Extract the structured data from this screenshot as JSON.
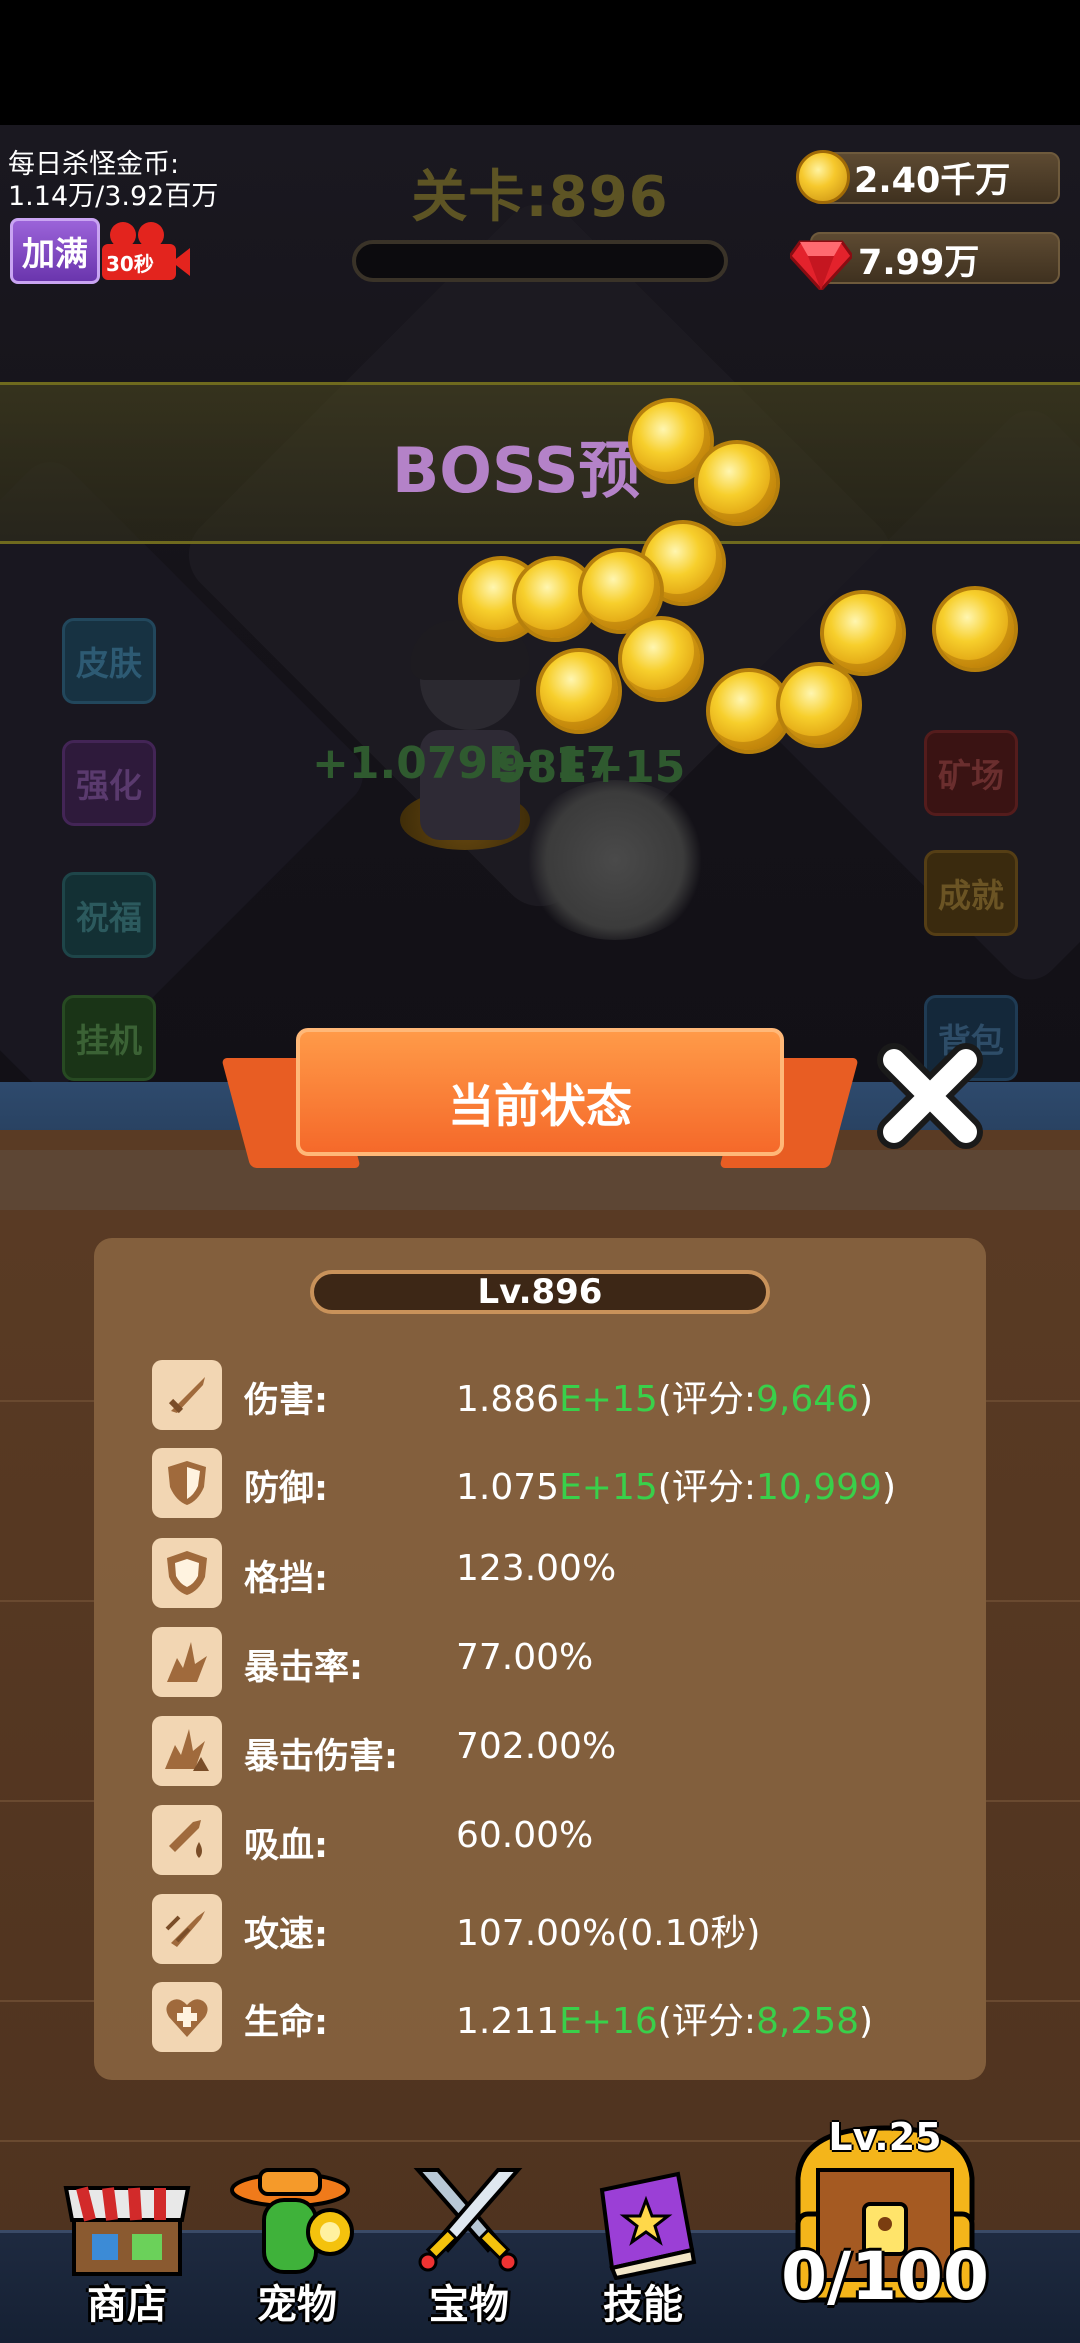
{
  "hud": {
    "kill_gold_label": "每日杀怪金币:",
    "kill_gold_value": "1.14万/3.92百万",
    "fill_button": "加满",
    "video_timer": "30秒",
    "level_title": "关卡:896",
    "gold": "2.40千万",
    "gems": "7.99万"
  },
  "scene": {
    "boss_banner": "BOSS预",
    "damage_popup_1": "+1.079E+17",
    "damage_popup_2": "98E+15"
  },
  "left_menu": [
    "皮肤",
    "强化",
    "祝福",
    "挂机"
  ],
  "right_menu": [
    "矿场",
    "成就",
    "背包"
  ],
  "status_panel": {
    "title": "当前状态",
    "level": "Lv.896",
    "stats": [
      {
        "icon": "sword-icon",
        "label": "伤害:",
        "base": "1.886",
        "exp": "E+15",
        "pre": "(评分:",
        "score": "9,646",
        "post": ")",
        "plain": ""
      },
      {
        "icon": "shield-icon",
        "label": "防御:",
        "base": "1.075",
        "exp": "E+15",
        "pre": "(评分:",
        "score": "10,999",
        "post": ")",
        "plain": ""
      },
      {
        "icon": "block-shield-icon",
        "label": "格挡:",
        "plain": "123.00%"
      },
      {
        "icon": "crit-burst-icon",
        "label": "暴击率:",
        "plain": "77.00%"
      },
      {
        "icon": "crit-damage-icon",
        "label": "暴击伤害:",
        "plain": "702.00%"
      },
      {
        "icon": "lifesteal-icon",
        "label": "吸血:",
        "plain": "60.00%"
      },
      {
        "icon": "attack-speed-icon",
        "label": "攻速:",
        "plain": "107.00%(0.10秒)"
      },
      {
        "icon": "heart-plus-icon",
        "label": "生命:",
        "base": "1.211",
        "exp": "E+16",
        "pre": "(评分:",
        "score": "8,258",
        "post": ")",
        "plain": ""
      }
    ]
  },
  "bottom_nav": {
    "shop": "商店",
    "pets": "宠物",
    "treasures": "宝物",
    "skills": "技能",
    "chest_level": "Lv.25",
    "chest_count": "0/100"
  },
  "colors": {
    "accent_green": "#39d04a",
    "panel_brown": "#8b6642",
    "header_orange": "#f5692a"
  }
}
